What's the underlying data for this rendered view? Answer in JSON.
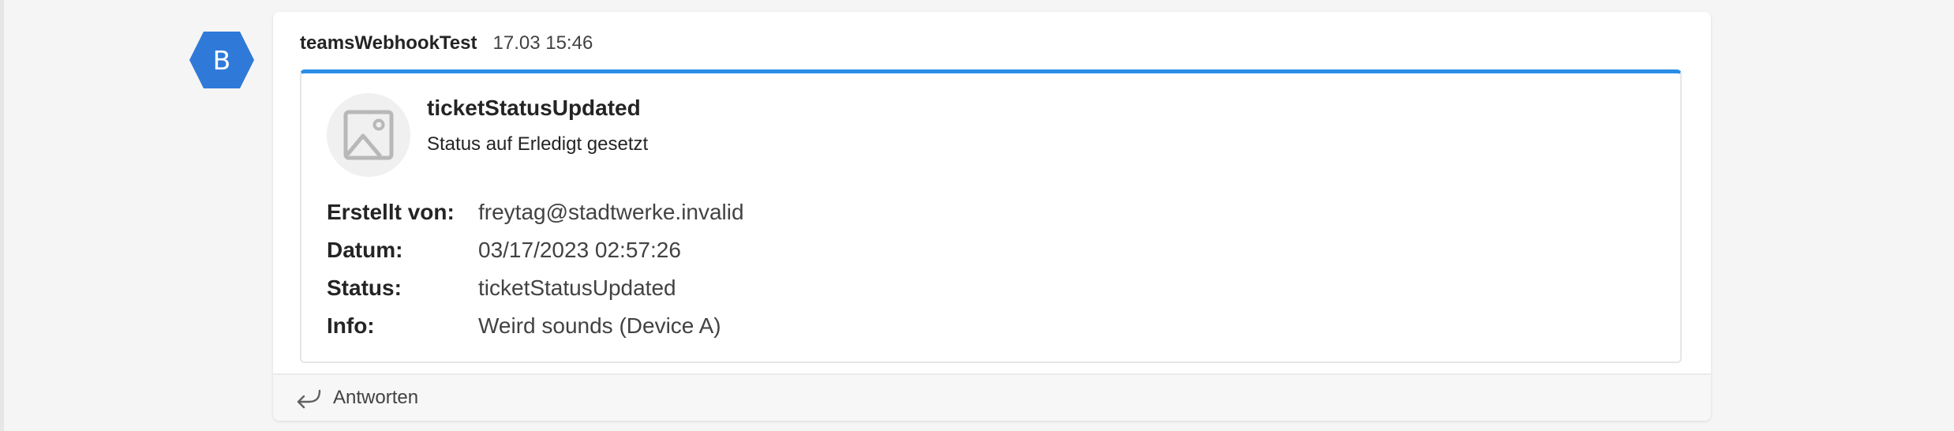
{
  "avatar": {
    "letter": "B",
    "color": "#2f7ad9",
    "icon": "hexagon-avatar"
  },
  "message": {
    "sender": "teamsWebhookTest",
    "timestamp": "17.03 15:46"
  },
  "card": {
    "accent_color": "#2b8ee6",
    "image_icon": "image-placeholder-icon",
    "title": "ticketStatusUpdated",
    "subtitle": "Status auf Erledigt gesetzt",
    "facts": [
      {
        "key": "Erstellt von:",
        "value": "freytag@stadtwerke.invalid"
      },
      {
        "key": "Datum:",
        "value": "03/17/2023 02:57:26"
      },
      {
        "key": "Status:",
        "value": "ticketStatusUpdated"
      },
      {
        "key": "Info:",
        "value": "Weird sounds (Device A)"
      }
    ]
  },
  "reply": {
    "label": "Antworten",
    "icon": "reply-arrow-icon"
  }
}
